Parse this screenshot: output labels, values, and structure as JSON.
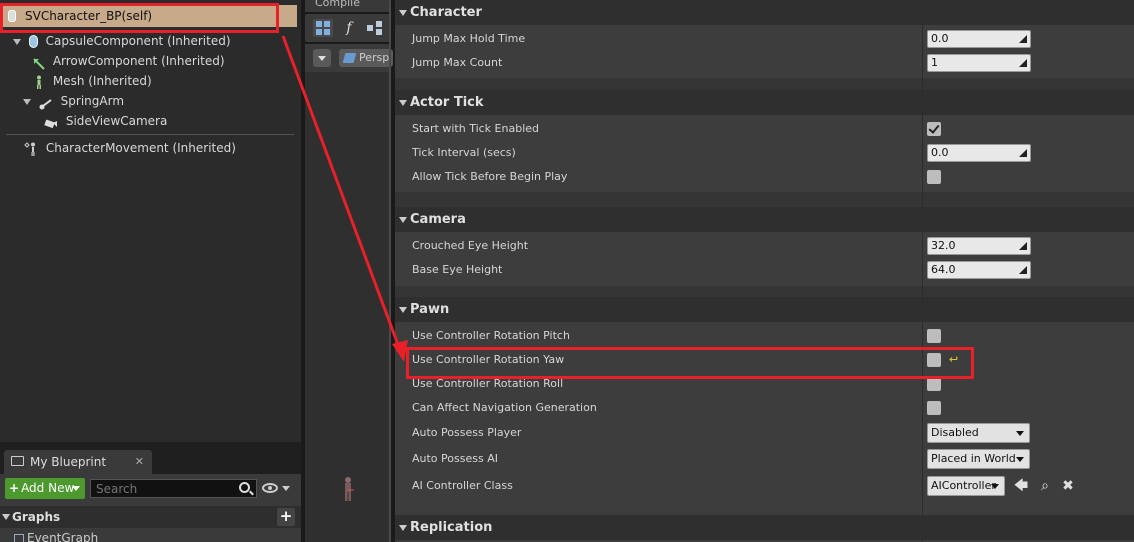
{
  "components": {
    "self": "SVCharacter_BP(self)",
    "capsule": "CapsuleComponent (Inherited)",
    "arrow": "ArrowComponent (Inherited)",
    "mesh": "Mesh (Inherited)",
    "springarm": "SpringArm",
    "camera": "SideViewCamera",
    "movement": "CharacterMovement (Inherited)"
  },
  "my_blueprint": {
    "tab_label": "My Blueprint",
    "close": "✕",
    "add_new": "Add New",
    "search_placeholder": "Search",
    "graphs_label": "Graphs",
    "graphs_add": "+",
    "eventgraph": "EventGraph"
  },
  "toolbar": {
    "compile": "Compile",
    "function_glyph": "f",
    "perspective": "Persp"
  },
  "details": {
    "character": {
      "header": "Character",
      "jump_max_hold_time_label": "Jump Max Hold Time",
      "jump_max_hold_time_value": "0.0",
      "jump_max_count_label": "Jump Max Count",
      "jump_max_count_value": "1"
    },
    "actor_tick": {
      "header": "Actor Tick",
      "start_tick_label": "Start with Tick Enabled",
      "start_tick_checked": true,
      "tick_interval_label": "Tick Interval (secs)",
      "tick_interval_value": "0.0",
      "allow_tick_label": "Allow Tick Before Begin Play",
      "allow_tick_checked": false
    },
    "camera": {
      "header": "Camera",
      "crouched_eye_label": "Crouched Eye Height",
      "crouched_eye_value": "32.0",
      "base_eye_label": "Base Eye Height",
      "base_eye_value": "64.0"
    },
    "pawn": {
      "header": "Pawn",
      "pitch_label": "Use Controller Rotation Pitch",
      "pitch_checked": false,
      "yaw_label": "Use Controller Rotation Yaw",
      "yaw_checked": false,
      "yaw_reset_glyph": "↩",
      "roll_label": "Use Controller Rotation Roll",
      "roll_checked": false,
      "nav_label": "Can Affect Navigation Generation",
      "nav_checked": false,
      "auto_possess_player_label": "Auto Possess Player",
      "auto_possess_player_value": "Disabled",
      "auto_possess_ai_label": "Auto Possess AI",
      "auto_possess_ai_value": "Placed in World",
      "ai_controller_label": "AI Controller Class",
      "ai_controller_value": "AIController",
      "use_glyph": "🡄",
      "browse_glyph": "⌕",
      "clear_glyph": "✖"
    },
    "replication": {
      "header": "Replication"
    }
  },
  "colors": {
    "annotation_red": "#e8202a",
    "selected_row": "#c8a989",
    "add_new_green": "#4c9a2e"
  }
}
